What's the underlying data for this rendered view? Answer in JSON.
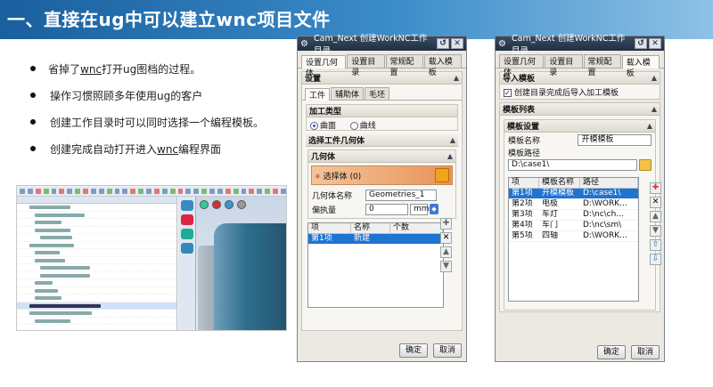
{
  "slide": {
    "title": "一、直接在ug中可以建立wnc项目文件",
    "bullets": [
      {
        "pre": "省掉了",
        "u": "wnc",
        "post": "打开ug图档的过程。"
      },
      {
        "pre": "操作习惯照顾多年使用ug的客户",
        "u": "",
        "post": ""
      },
      {
        "pre": "创建工作目录时可以同时选择一个编程模板。",
        "u": "",
        "post": ""
      },
      {
        "pre": "创建完成自动打开进入",
        "u": "wnc",
        "post": "编程界面"
      }
    ]
  },
  "dialog1": {
    "title": "Cam_Next 创建WorkNC工作目录",
    "tabs": [
      "设置几何体",
      "设置目录",
      "常规配置",
      "载入模板"
    ],
    "settings_label": "设置",
    "subtabs": [
      "工件",
      "辅助体",
      "毛坯"
    ],
    "process_type_label": "加工类型",
    "process_options": [
      "曲面",
      "曲线"
    ],
    "select_geometry_label": "选择工件几何体",
    "geometry_label": "几何体",
    "select_geometry_btn": "选择体 (0)",
    "geometry_name_label": "几何体名称",
    "geometry_name_value": "Geometries_1",
    "offset_label": "偏执量",
    "offset_value": "0",
    "offset_unit": "mm",
    "table_headers": [
      "项",
      "名称",
      "个数"
    ],
    "table_rows": [
      [
        "第1项",
        "新建",
        ""
      ]
    ],
    "ok": "确定",
    "cancel": "取消"
  },
  "dialog2": {
    "title": "Cam_Next 创建WorkNC工作目录",
    "tabs": [
      "设置几何体",
      "设置目录",
      "常规配置",
      "载入模板"
    ],
    "import_template_label": "导入模板",
    "import_checkbox_label": "创建目录完成后导入加工模板",
    "template_list_label": "模板列表",
    "template_settings_label": "模板设置",
    "template_name_label": "模板名称",
    "template_name_value": "开模模板",
    "template_path_label": "模板路径",
    "template_path_value": "D:\\case1\\",
    "table_headers": [
      "项",
      "模板名称",
      "路径"
    ],
    "table_rows": [
      [
        "第1项",
        "开模模板",
        "D:\\case1\\"
      ],
      [
        "第2项",
        "电极",
        "D:\\WORK..."
      ],
      [
        "第3项",
        "车灯",
        "D:\\nc\\ch..."
      ],
      [
        "第4项",
        "车门",
        "D:\\nc\\sm\\"
      ],
      [
        "第5项",
        "四轴",
        "D:\\WORK..."
      ]
    ],
    "ok": "确定",
    "cancel": "取消"
  }
}
